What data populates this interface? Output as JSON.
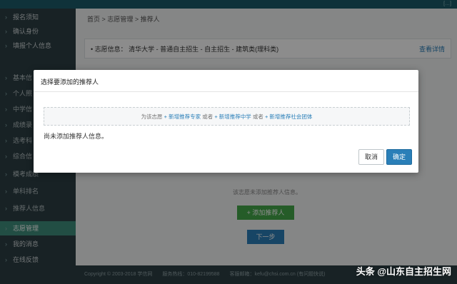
{
  "topbar": {
    "links": "[…]"
  },
  "sidebar": {
    "items": [
      {
        "label": "报名须知",
        "chevron": "›"
      },
      {
        "label": "确认身份",
        "chevron": "›"
      },
      {
        "label": "填报个人信息",
        "chevron": "›"
      },
      {
        "label": "基本信",
        "chevron": "›"
      },
      {
        "label": "个人照",
        "chevron": "›"
      },
      {
        "label": "中学信",
        "chevron": "›"
      },
      {
        "label": "成绩录",
        "chevron": "›"
      },
      {
        "label": "选考科",
        "chevron": "›"
      },
      {
        "label": "综合信",
        "chevron": "›"
      },
      {
        "label": "模考成绩",
        "chevron": "›"
      },
      {
        "label": "单科排名",
        "chevron": "›"
      },
      {
        "label": "推荐人信息",
        "chevron": "›"
      },
      {
        "label": "志愿管理",
        "chevron": "›"
      },
      {
        "label": "我的消息",
        "chevron": "›"
      },
      {
        "label": "在线反馈",
        "chevron": "›"
      }
    ]
  },
  "breadcrumb": {
    "home": "首页",
    "sep1": ">",
    "level1": "志愿管理",
    "sep2": ">",
    "level2": "推荐人"
  },
  "infobar": {
    "title": "• 志愿信息： 清华大学 - 普通自主招生 - 自主招生 - 建筑类(理科类)",
    "detail": "查看详情"
  },
  "content": {
    "empty_text": "该志愿未添加推荐人信息。",
    "add_button": "+ 添加推荐人",
    "next_button": "下一步"
  },
  "footer": {
    "copyright": "Copyright © 2003-2018 学信网",
    "hotline": "服务热线：010-82199588",
    "email": "客服邮箱：kefu@chsi.com.cn (有问题快说)"
  },
  "modal": {
    "title": "选择要添加的推荐人",
    "prompt": "为该志愿",
    "link1": "+ 新增推荐专家",
    "or1": "或者",
    "link2": "+ 新增推荐中学",
    "or2": "或者",
    "link3": "+ 新增推荐社会团体",
    "empty_msg": "尚未添加推荐人信息。",
    "cancel": "取消",
    "confirm": "确定"
  },
  "watermark": "头条 @山东自主招生网",
  "colors": {
    "accent": "#2a7fb8",
    "sidebar_bg": "#2c3e44",
    "active": "#3f8f7c",
    "success": "#44a84a"
  }
}
